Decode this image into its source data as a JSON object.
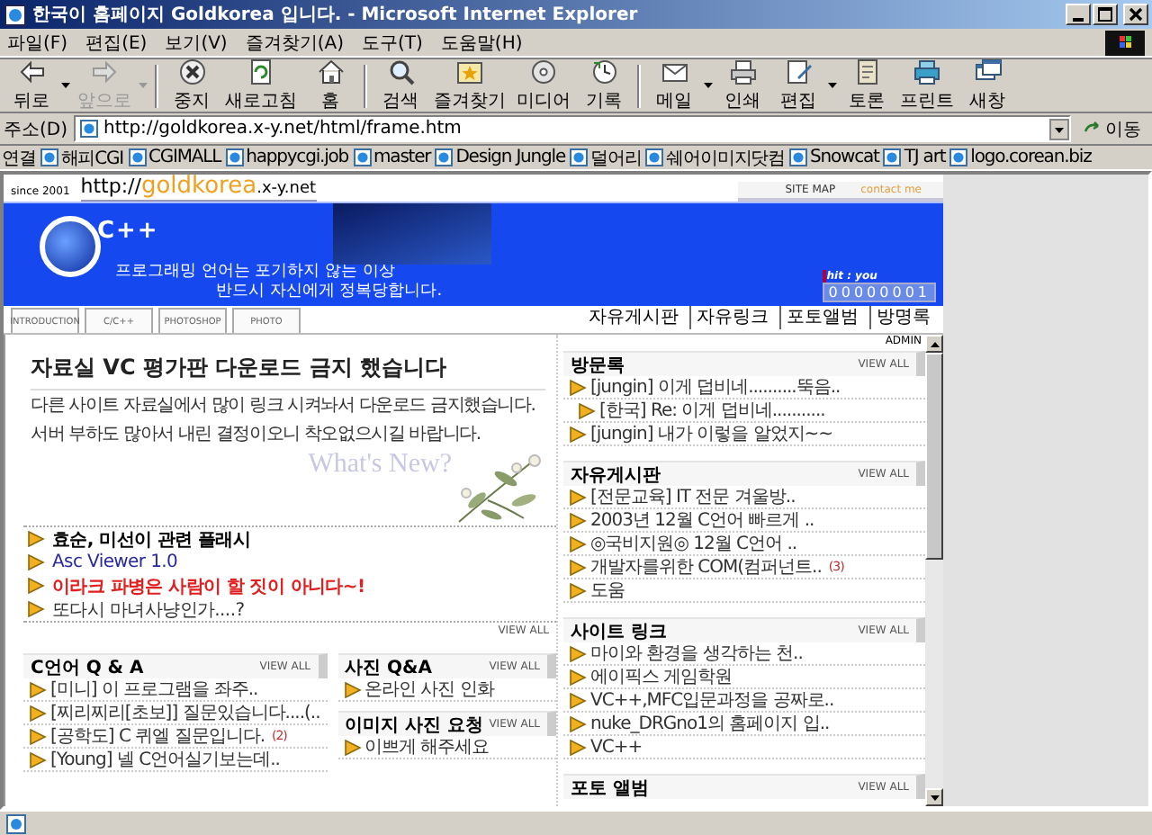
{
  "window": {
    "title": "한국이 홈페이지 Goldkorea 입니다. - Microsoft Internet Explorer"
  },
  "menu": [
    "파일(F)",
    "편집(E)",
    "보기(V)",
    "즐겨찾기(A)",
    "도구(T)",
    "도움말(H)"
  ],
  "toolbar": [
    {
      "label": "뒤로",
      "dropdown": true,
      "disabled": false
    },
    {
      "label": "앞으로",
      "dropdown": true,
      "disabled": true
    },
    {
      "label": "중지",
      "dropdown": false,
      "disabled": false
    },
    {
      "label": "새로고침",
      "dropdown": false,
      "disabled": false
    },
    {
      "label": "홈",
      "dropdown": false,
      "disabled": false
    },
    {
      "label": "검색",
      "dropdown": false,
      "disabled": false
    },
    {
      "label": "즐겨찾기",
      "dropdown": false,
      "disabled": false
    },
    {
      "label": "미디어",
      "dropdown": false,
      "disabled": false
    },
    {
      "label": "기록",
      "dropdown": false,
      "disabled": false
    },
    {
      "label": "메일",
      "dropdown": true,
      "disabled": false
    },
    {
      "label": "인쇄",
      "dropdown": false,
      "disabled": false
    },
    {
      "label": "편집",
      "dropdown": true,
      "disabled": false
    },
    {
      "label": "토론",
      "dropdown": false,
      "disabled": false
    },
    {
      "label": "프린트",
      "dropdown": false,
      "disabled": false
    },
    {
      "label": "새창",
      "dropdown": false,
      "disabled": false
    }
  ],
  "address": {
    "label": "주소(D)",
    "value": "http://goldkorea.x-y.net/html/frame.htm",
    "go": "이동"
  },
  "links": {
    "label": "연결",
    "items": [
      "해피CGI",
      "CGIMALL",
      "happycgi.job",
      "master",
      "Design Jungle",
      "덜어리",
      "쉐어이미지닷컴",
      "Snowcat",
      "TJ art",
      "logo.corean.biz"
    ]
  },
  "site": {
    "since": "since 2001",
    "url": [
      "http://",
      "goldkorea",
      ".x-y.net"
    ],
    "top_links": [
      "SITE MAP",
      "contact me"
    ]
  },
  "banner": {
    "logo_text": "C++",
    "slogan": [
      "프로그래밍 언어는 포기하지 않는 이상",
      "반드시 자신에게 정복당합니다."
    ],
    "hit_label": "hit : you",
    "counter": "00000001"
  },
  "nav_tabs": [
    "INTRODUCTION",
    "C/C++",
    "PHOTOSHOP",
    "PHOTO"
  ],
  "sub_links": [
    "자유게시판",
    "자유링크",
    "포토앨범",
    "방명록"
  ],
  "admin": "ADMIN",
  "notice": {
    "title": "자료실 VC 평가판 다운로드 금지 했습니다",
    "paragraphs": [
      "다른 사이트 자료실에서 많이 링크 시켜놔서 다운로드 금지했습니다.",
      "서버 부하도 많아서 내린 결정이오니 착오없으시길 바랍니다."
    ],
    "art_text": "What's New?"
  },
  "news": {
    "items": [
      {
        "text": "효순, 미선이 관련 플래시",
        "kind": "bold"
      },
      {
        "text": "Asc Viewer 1.0",
        "kind": "link"
      },
      {
        "text": "이라크 파병은 사람이 할 짓이 아니다~!",
        "kind": "alert"
      },
      {
        "text": "또다시 마녀사냥인가....?",
        "kind": "plain"
      }
    ],
    "view_all": "VIEW ALL"
  },
  "bottom_boards": [
    {
      "title": "C언어 Q & A",
      "view_all": "VIEW ALL",
      "items": [
        {
          "text": "[미니] 이 프로그램을 좌주.."
        },
        {
          "text": "[찌리찌리[초보]] 질문있습니다....(.."
        },
        {
          "text": "[공학도] C 퀴엘 질문입니다.",
          "count": "(2)"
        },
        {
          "text": "[Young] 넬 C언어실기보는데.."
        }
      ]
    },
    {
      "title": "사진 Q&A",
      "view_all": "VIEW ALL",
      "items": [
        {
          "text": "온라인 사진 인화"
        }
      ]
    },
    {
      "title": "이미지 사진 요청",
      "view_all": "VIEW ALL",
      "items": [
        {
          "text": "이쁘게 해주세요"
        }
      ]
    }
  ],
  "side_boards": [
    {
      "title": "방문록",
      "view_all": "VIEW ALL",
      "items": [
        {
          "text": "[jungin] 이게 덥비네..........뚝음..",
          "reply": false
        },
        {
          "text": "[한국] Re: 이게 덥비네...........",
          "reply": true
        },
        {
          "text": "[jungin] 내가 이렇을 알었지~~",
          "reply": false
        }
      ]
    },
    {
      "title": "자유게시판",
      "view_all": "VIEW ALL",
      "items": [
        {
          "text": "[전문교육] IT 전문 겨울방.."
        },
        {
          "text": "2003년 12월 C언어 빠르게 .."
        },
        {
          "text": "◎국비지원◎ 12월 C언어 .."
        },
        {
          "text": "개발자를위한 COM(컴퍼넌트..",
          "count": "(3)"
        },
        {
          "text": "도움"
        }
      ]
    },
    {
      "title": "사이트 링크",
      "view_all": "VIEW ALL",
      "items": [
        {
          "text": "마이와 환경을 생각하는 천.."
        },
        {
          "text": "에이픽스 게임학원"
        },
        {
          "text": "VC++,MFC입문과정을 공짜로.."
        },
        {
          "text": "nuke_DRGno1의 홈페이지 입.."
        },
        {
          "text": "VC++"
        }
      ]
    },
    {
      "title": "포토 앨범",
      "view_all": "VIEW ALL"
    }
  ]
}
